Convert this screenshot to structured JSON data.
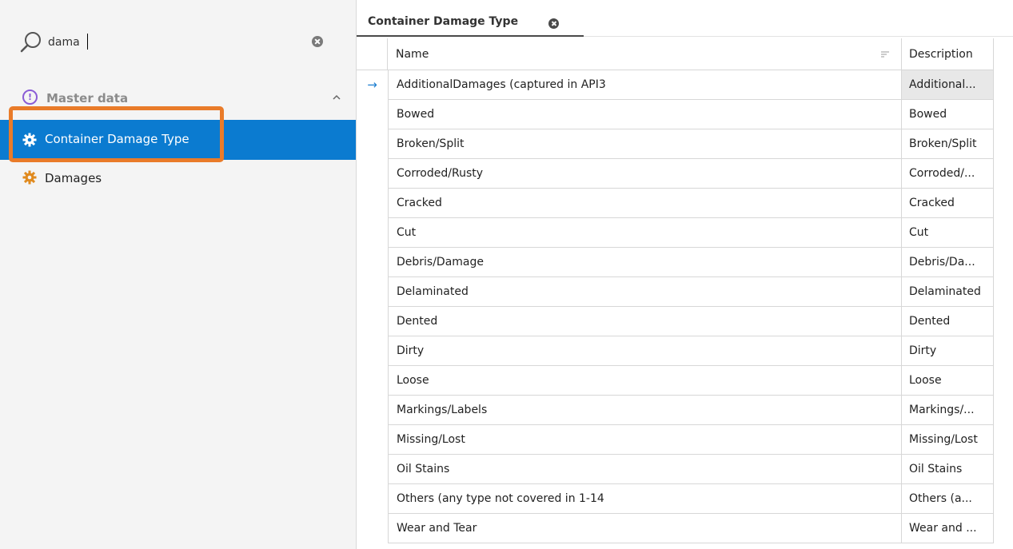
{
  "search": {
    "value": "dama"
  },
  "nav": {
    "group_label": "Master data",
    "items": [
      {
        "label": "Container Damage Type",
        "selected": true
      },
      {
        "label": "Damages",
        "selected": false
      }
    ]
  },
  "tab": {
    "label": "Container Damage Type"
  },
  "grid": {
    "columns": {
      "name": "Name",
      "description": "Description"
    },
    "rows": [
      {
        "name": "AdditionalDamages (captured in API3",
        "description": "Additional..."
      },
      {
        "name": "Bowed",
        "description": "Bowed"
      },
      {
        "name": "Broken/Split",
        "description": "Broken/Split"
      },
      {
        "name": "Corroded/Rusty",
        "description": "Corroded/..."
      },
      {
        "name": "Cracked",
        "description": "Cracked"
      },
      {
        "name": "Cut",
        "description": "Cut"
      },
      {
        "name": "Debris/Damage",
        "description": "Debris/Da..."
      },
      {
        "name": "Delaminated",
        "description": "Delaminated"
      },
      {
        "name": "Dented",
        "description": "Dented"
      },
      {
        "name": "Dirty",
        "description": "Dirty"
      },
      {
        "name": "Loose",
        "description": "Loose"
      },
      {
        "name": "Markings/Labels",
        "description": "Markings/..."
      },
      {
        "name": "Missing/Lost",
        "description": "Missing/Lost"
      },
      {
        "name": "Oil Stains",
        "description": "Oil Stains"
      },
      {
        "name": "Others (any type not covered in 1-14",
        "description": "Others (a..."
      },
      {
        "name": "Wear and Tear",
        "description": "Wear and ..."
      }
    ],
    "focused_row_indicator": "→"
  },
  "colors": {
    "selection": "#0b7bd0",
    "highlight_box": "#e97b29",
    "group_icon": "#8a5cd6",
    "gear_icon": "#e08a1e",
    "row_indicator": "#1d7fd0"
  },
  "icons": {
    "search": "magnifier-icon",
    "clear": "clear-circle-icon",
    "group": "master-data-icon",
    "nav_item": "gear-icon",
    "collapse": "chevron-up-icon",
    "sort": "sort-icon",
    "tab_close": "close-circle-icon",
    "row_indicator": "arrow-right-icon"
  }
}
